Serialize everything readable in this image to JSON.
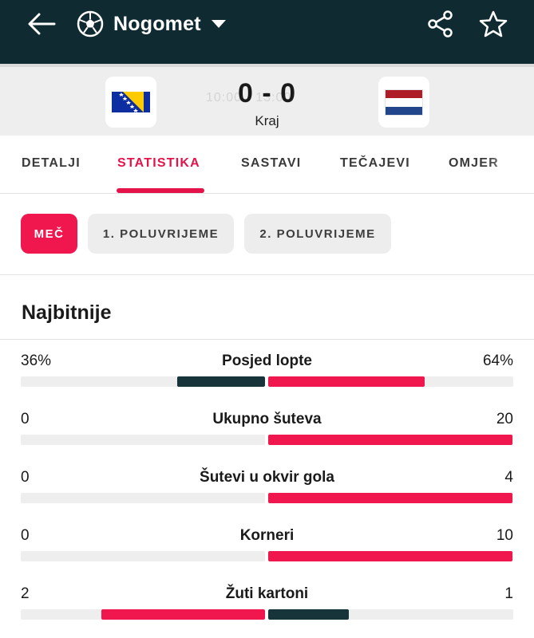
{
  "header": {
    "sport_title": "Nogomet",
    "icons": {
      "back": "arrow-left-icon",
      "sport": "soccer-ball-icon",
      "dropdown": "caret-down-icon",
      "share": "share-icon",
      "favorite": "star-outline-icon"
    }
  },
  "match": {
    "home_team_flag": "bosnia-and-herzegovina-flag",
    "away_team_flag": "netherlands-flag",
    "score": "0 - 0",
    "status": "Kraj"
  },
  "tabs": [
    {
      "label": "DETALJI",
      "active": false
    },
    {
      "label": "STATISTIKA",
      "active": true
    },
    {
      "label": "SASTAVI",
      "active": false
    },
    {
      "label": "TEČAJEVI",
      "active": false
    },
    {
      "label": "OMJER",
      "active": false
    }
  ],
  "periods": [
    {
      "label": "MEČ",
      "active": true
    },
    {
      "label": "1. POLUVRIJEME",
      "active": false
    },
    {
      "label": "2. POLUVRIJEME",
      "active": false
    }
  ],
  "section": {
    "title": "Najbitnije"
  },
  "stats": [
    {
      "label": "Posjed lopte",
      "home": "36%",
      "away": "64%",
      "home_share": 0.36,
      "away_share": 0.64,
      "home_leads": false,
      "away_leads": true
    },
    {
      "label": "Ukupno šuteva",
      "home": "0",
      "away": "20",
      "home_share": 0.0,
      "away_share": 1.0,
      "home_leads": false,
      "away_leads": true
    },
    {
      "label": "Šutevi u okvir gola",
      "home": "0",
      "away": "4",
      "home_share": 0.0,
      "away_share": 1.0,
      "home_leads": false,
      "away_leads": true
    },
    {
      "label": "Korneri",
      "home": "0",
      "away": "10",
      "home_share": 0.0,
      "away_share": 1.0,
      "home_leads": false,
      "away_leads": true
    },
    {
      "label": "Žuti kartoni",
      "home": "2",
      "away": "1",
      "home_share": 0.67,
      "away_share": 0.33,
      "home_leads": true,
      "away_leads": false
    }
  ],
  "colors": {
    "topbar": "#0f2a31",
    "accent": "#e4134a",
    "leader_bar": "#f0164e",
    "trailer_bar": "#17343a",
    "track": "#eeeeee"
  }
}
